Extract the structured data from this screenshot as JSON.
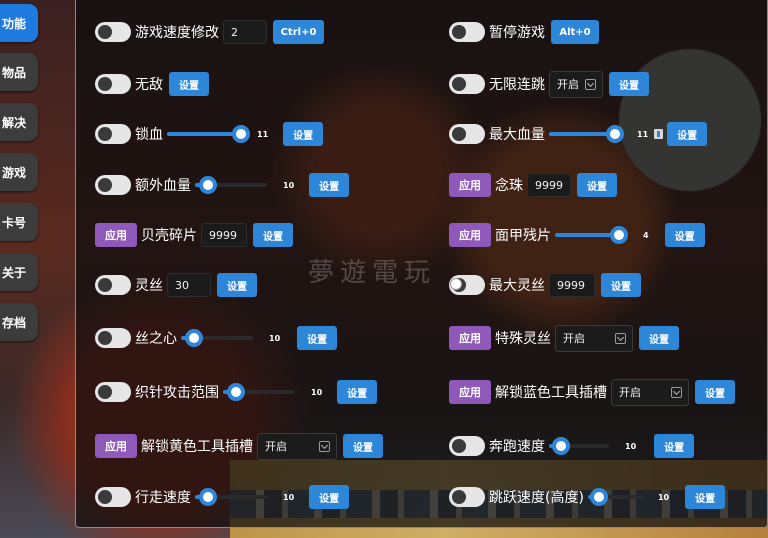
{
  "sidebar": {
    "items": [
      {
        "label": "功能",
        "active": true
      },
      {
        "label": "物品",
        "active": false
      },
      {
        "label": "解决",
        "active": false
      },
      {
        "label": "游戏",
        "active": false
      },
      {
        "label": "卡号",
        "active": false
      },
      {
        "label": "关于",
        "active": false
      },
      {
        "label": "存档",
        "active": false
      }
    ]
  },
  "watermark": "夢遊電玩",
  "rows": {
    "r1l": {
      "label": "游戏速度修改",
      "value": "2",
      "button": "Ctrl+0"
    },
    "r1r": {
      "label": "暂停游戏",
      "button": "Alt+0"
    },
    "r2l": {
      "label": "无敌",
      "button": "设置"
    },
    "r2r": {
      "label": "无限连跳",
      "select": "开启",
      "button": "设置"
    },
    "r3l": {
      "label": "锁血",
      "slider_value": "11",
      "button": "设置"
    },
    "r3r": {
      "label": "最大血量",
      "slider_value": "11",
      "button": "设置"
    },
    "r4l": {
      "label": "额外血量",
      "slider_value": "10",
      "button": "设置"
    },
    "r4r": {
      "apply": "应用",
      "label": "念珠",
      "value": "9999",
      "button": "设置"
    },
    "r5l": {
      "apply": "应用",
      "label": "贝壳碎片",
      "value": "9999",
      "button": "设置"
    },
    "r5r": {
      "apply": "应用",
      "label": "面甲残片",
      "slider_value": "4",
      "button": "设置"
    },
    "r6l": {
      "label": "灵丝",
      "value": "30",
      "button": "设置"
    },
    "r6r": {
      "label": "最大灵丝",
      "value": "9999",
      "button": "设置"
    },
    "r7l": {
      "label": "丝之心",
      "slider_value": "10",
      "button": "设置"
    },
    "r7r": {
      "apply": "应用",
      "label": "特殊灵丝",
      "select": "开启",
      "button": "设置"
    },
    "r8l": {
      "label": "织针攻击范围",
      "slider_value": "10",
      "button": "设置"
    },
    "r8r": {
      "apply": "应用",
      "label": "解锁蓝色工具插槽",
      "select": "开启",
      "button": "设置"
    },
    "r9l": {
      "apply": "应用",
      "label": "解锁黄色工具插槽",
      "select": "开启",
      "button": "设置"
    },
    "r9r": {
      "label": "奔跑速度",
      "slider_value": "10",
      "button": "设置"
    },
    "r10l": {
      "label": "行走速度",
      "slider_value": "10",
      "button": "设置"
    },
    "r10r": {
      "label": "跳跃速度(高度)",
      "slider_value": "10",
      "button": "设置"
    }
  }
}
